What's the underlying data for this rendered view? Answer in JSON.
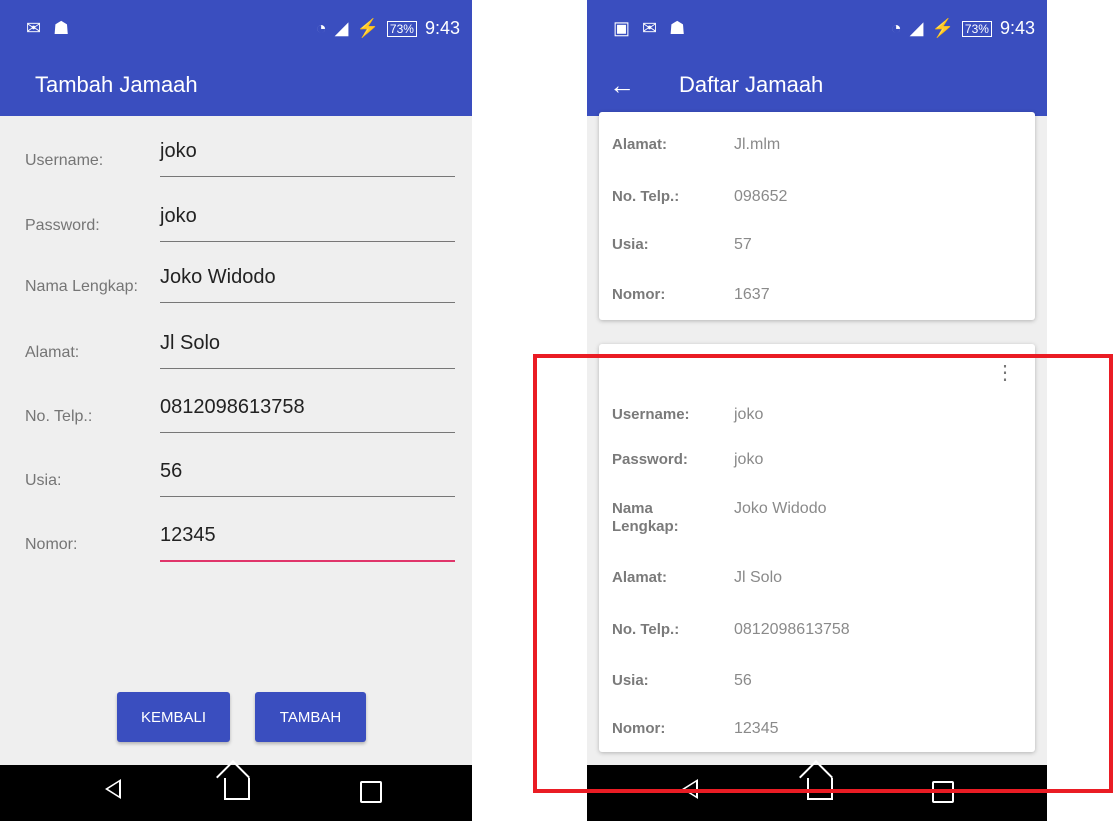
{
  "left_screen": {
    "status": {
      "battery": "73%",
      "time": "9:43"
    },
    "title": "Tambah Jamaah",
    "fields": [
      {
        "label": "Username:",
        "value": "joko"
      },
      {
        "label": "Password:",
        "value": "joko"
      },
      {
        "label": "Nama Lengkap:",
        "value": "Joko Widodo"
      },
      {
        "label": "Alamat:",
        "value": "Jl Solo"
      },
      {
        "label": "No. Telp.:",
        "value": "0812098613758"
      },
      {
        "label": "Usia:",
        "value": "56"
      },
      {
        "label": "Nomor:",
        "value": "12345"
      }
    ],
    "buttons": {
      "kembali": "KEMBALI",
      "tambah": "TAMBAH"
    }
  },
  "right_screen": {
    "status": {
      "battery": "73%",
      "time": "9:43"
    },
    "title": "Daftar Jamaah",
    "card1": [
      {
        "key": "Alamat:",
        "value": "Jl.mlm"
      },
      {
        "key": "No. Telp.:",
        "value": "098652"
      },
      {
        "key": "Usia:",
        "value": "57"
      },
      {
        "key": "Nomor:",
        "value": "1637"
      }
    ],
    "card2": [
      {
        "key": "Username:",
        "value": "joko"
      },
      {
        "key": "Password:",
        "value": "joko"
      },
      {
        "key": "Nama Lengkap:",
        "value": "Joko Widodo"
      },
      {
        "key": "Alamat:",
        "value": "Jl Solo"
      },
      {
        "key": "No. Telp.:",
        "value": "0812098613758"
      },
      {
        "key": "Usia:",
        "value": "56"
      },
      {
        "key": "Nomor:",
        "value": "12345"
      }
    ]
  },
  "colors": {
    "primary": "#3a4ebf",
    "accent_line": "#e0356a",
    "highlight": "#ea1c24"
  },
  "icons": [
    "message-icon",
    "android-icon",
    "image-icon",
    "wifi-icon",
    "signal-icon",
    "battery-icon",
    "back-arrow-icon",
    "overflow-menu-icon",
    "nav-back-icon",
    "nav-home-icon",
    "nav-recent-icon"
  ]
}
